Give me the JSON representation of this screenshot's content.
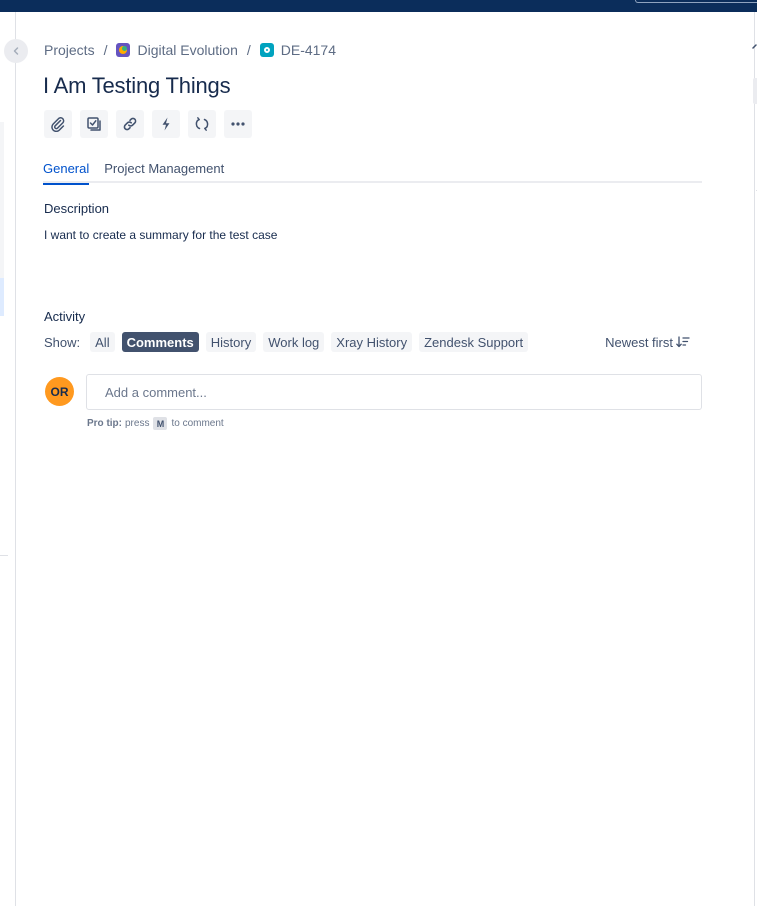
{
  "breadcrumb": {
    "projects": "Projects",
    "separator": "/",
    "project_name": "Digital Evolution",
    "issue_key": "DE-4174"
  },
  "issue": {
    "title": "I Am Testing Things"
  },
  "toolbar": {
    "buttons": [
      {
        "icon": "paperclip-icon"
      },
      {
        "icon": "checklist-icon"
      },
      {
        "icon": "link-icon"
      },
      {
        "icon": "lightning-icon"
      },
      {
        "icon": "sync-icon"
      },
      {
        "icon": "more-icon"
      }
    ]
  },
  "tabs": [
    {
      "label": "General",
      "active": true
    },
    {
      "label": "Project Management",
      "active": false
    }
  ],
  "description": {
    "label": "Description",
    "text": "I want to create a summary for the test case"
  },
  "activity": {
    "label": "Activity",
    "show_label": "Show:",
    "filters": [
      {
        "label": "All",
        "active": false
      },
      {
        "label": "Comments",
        "active": true
      },
      {
        "label": "History",
        "active": false
      },
      {
        "label": "Work log",
        "active": false
      },
      {
        "label": "Xray History",
        "active": false
      },
      {
        "label": "Zendesk Support",
        "active": false
      }
    ],
    "sort_label": "Newest first"
  },
  "comment": {
    "avatar_initials": "OR",
    "placeholder": "Add a comment...",
    "protip_strong": "Pro tip:",
    "protip_press": "press",
    "protip_key": "M",
    "protip_rest": "to comment"
  },
  "colors": {
    "topbar": "#0b2d5b",
    "accent": "#0052cc",
    "avatar": "#ff991f",
    "active_filter": "#42526e"
  }
}
